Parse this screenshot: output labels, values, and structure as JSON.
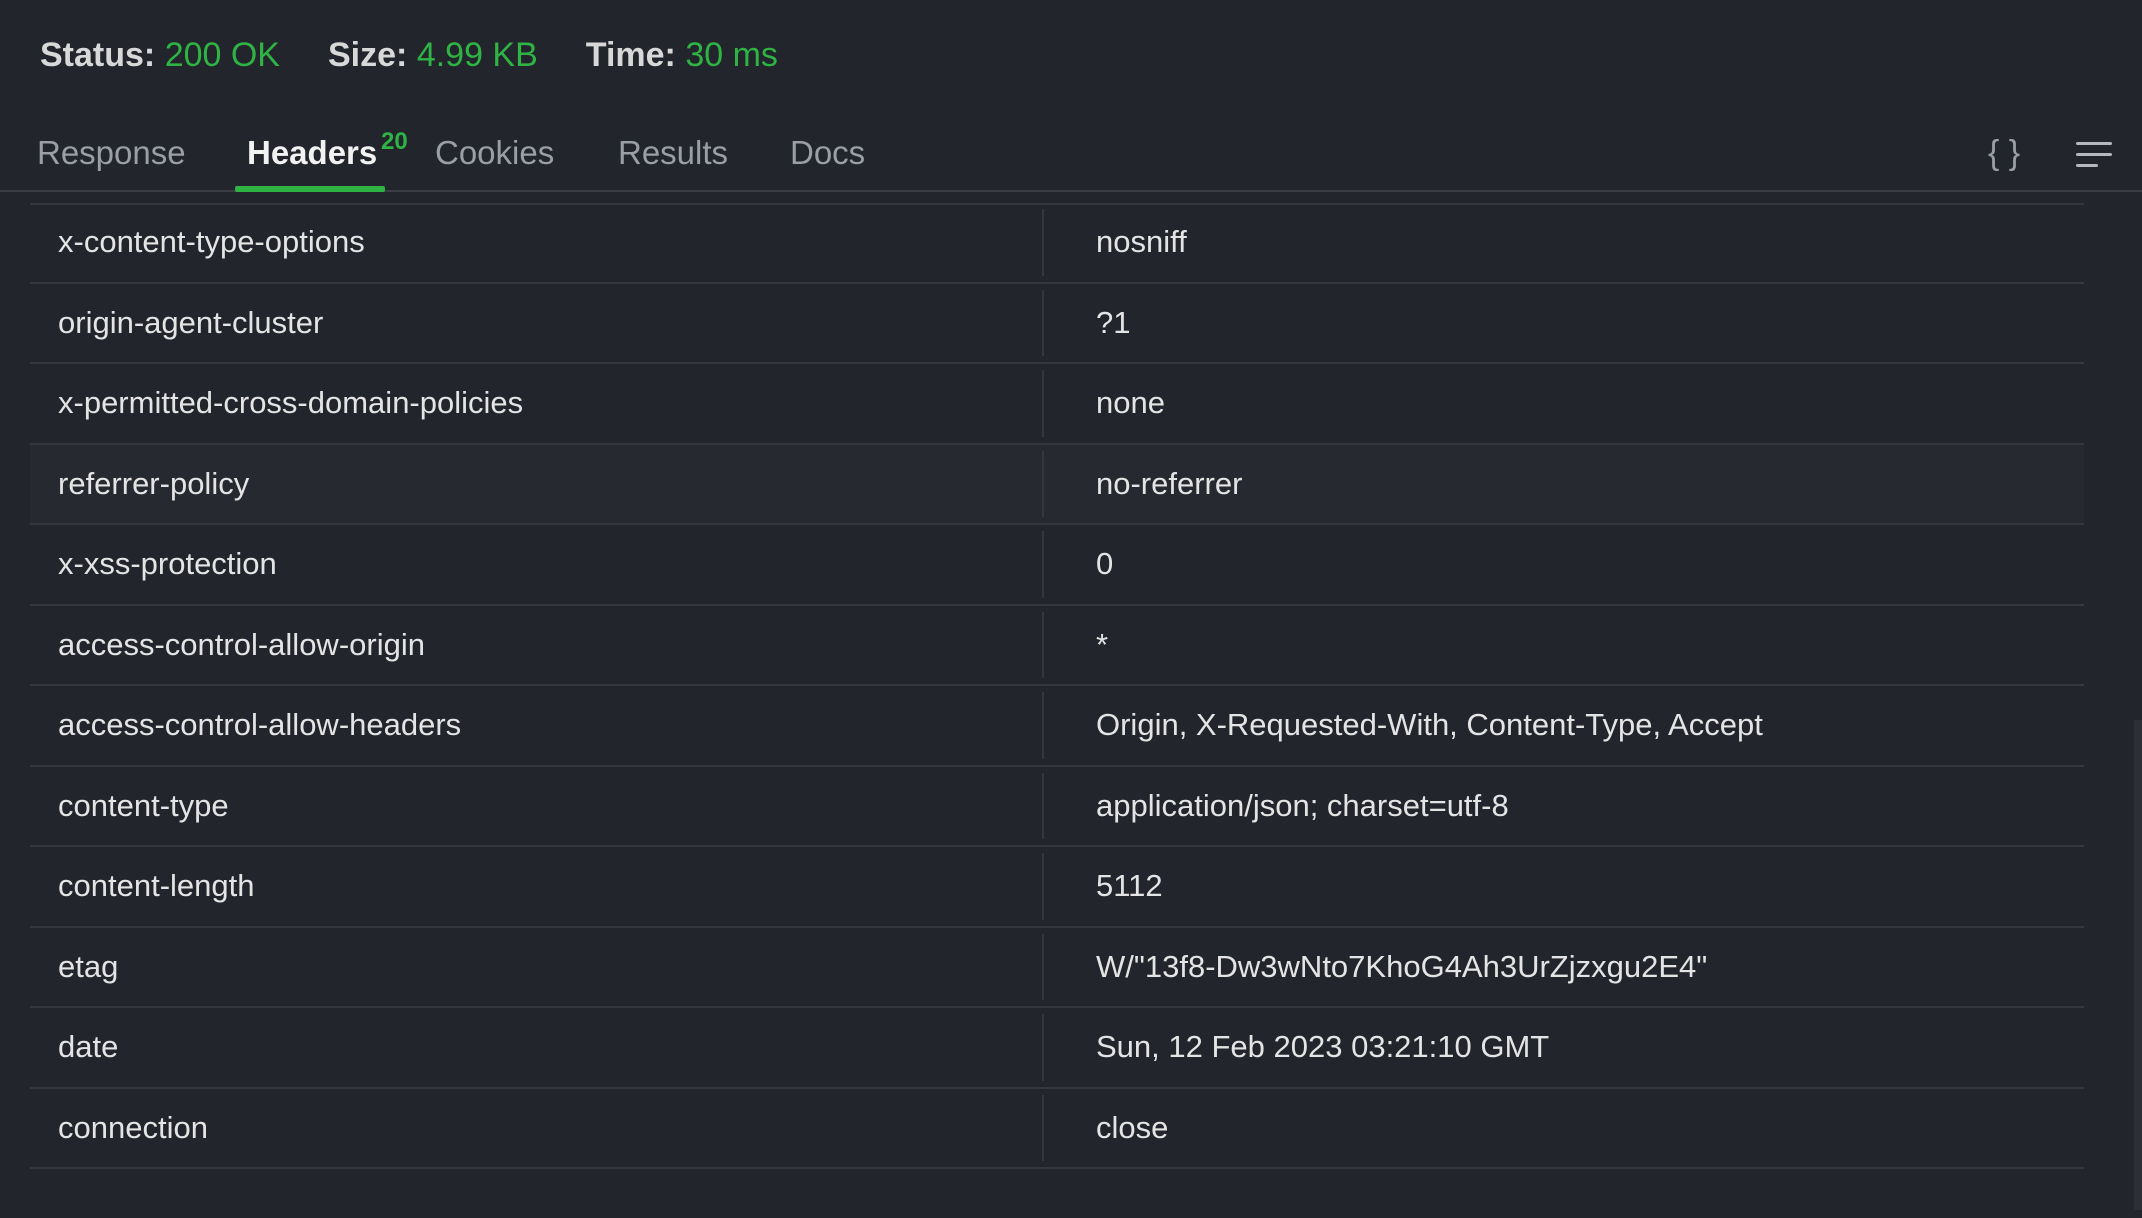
{
  "status": {
    "status_label": "Status:",
    "status_value": "200 OK",
    "size_label": "Size:",
    "size_value": "4.99 KB",
    "time_label": "Time:",
    "time_value": "30 ms"
  },
  "tabs": [
    {
      "label": "Response"
    },
    {
      "label": "Headers",
      "badge": "20",
      "active": true
    },
    {
      "label": "Cookies"
    },
    {
      "label": "Results"
    },
    {
      "label": "Docs"
    }
  ],
  "toolbar": {
    "format_icon": "{ }",
    "menu_icon": "hamburger-menu-icon"
  },
  "headers": [
    {
      "key": "x-content-type-options",
      "value": "nosniff"
    },
    {
      "key": "origin-agent-cluster",
      "value": "?1"
    },
    {
      "key": "x-permitted-cross-domain-policies",
      "value": "none"
    },
    {
      "key": "referrer-policy",
      "value": "no-referrer"
    },
    {
      "key": "x-xss-protection",
      "value": "0"
    },
    {
      "key": "access-control-allow-origin",
      "value": "*"
    },
    {
      "key": "access-control-allow-headers",
      "value": "Origin, X-Requested-With, Content-Type, Accept"
    },
    {
      "key": "content-type",
      "value": "application/json; charset=utf-8"
    },
    {
      "key": "content-length",
      "value": "5112"
    },
    {
      "key": "etag",
      "value": "W/\"13f8-Dw3wNto7KhoG4Ah3UrZjzxgu2E4\""
    },
    {
      "key": "date",
      "value": "Sun, 12 Feb 2023 03:21:10 GMT"
    },
    {
      "key": "connection",
      "value": "close"
    }
  ],
  "colors": {
    "accent": "#2fb344",
    "background": "#22252b"
  }
}
